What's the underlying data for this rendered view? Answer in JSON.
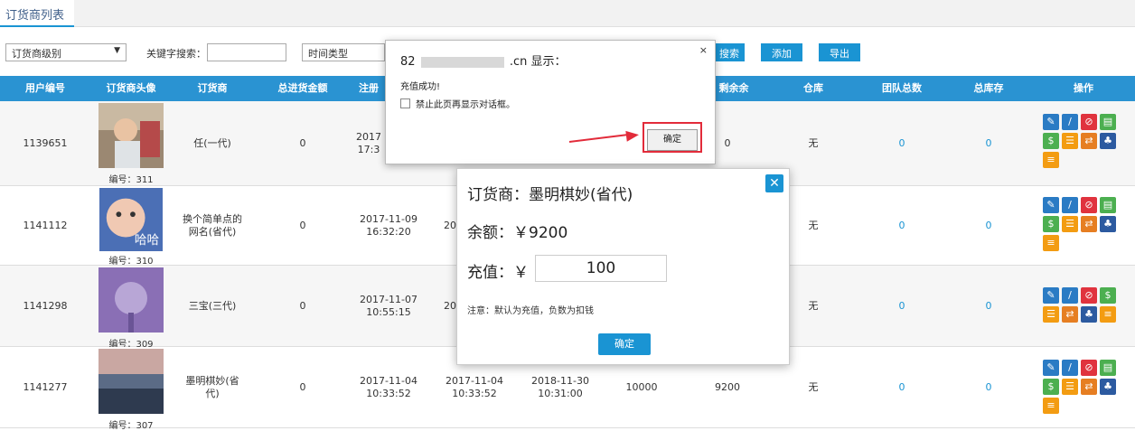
{
  "tab": {
    "label": "订货商列表"
  },
  "filters": {
    "level_select": "订货商级别",
    "keyword_label": "关键字搜索：",
    "keyword_value": "",
    "time_type_select": "时间类型",
    "search_label": "搜索",
    "add_label": "添加",
    "export_label": "导出"
  },
  "table": {
    "headers": [
      "用户编号",
      "订货商头像",
      "订货商",
      "总进货金额",
      "注册",
      "",
      "",
      "剩余余额",
      "仓库",
      "团队总数",
      "总库存",
      "操作"
    ],
    "rows": [
      {
        "id": "1139651",
        "avatar_no": "编号：311",
        "name": "任(一代)",
        "total": "0",
        "reg_date": "2017",
        "reg_time": "17:3",
        "c6": "",
        "c7": "",
        "balance": "0",
        "warehouse": "无",
        "team": "0",
        "stock": "0"
      },
      {
        "id": "1141112",
        "avatar_no": "编号：310",
        "name": "换个简单点的网名(省代)",
        "total": "0",
        "reg_date": "2017-11-09",
        "reg_time": "16:32:20",
        "c6": "20",
        "c7": "",
        "balance": "",
        "warehouse": "无",
        "team": "0",
        "stock": "0"
      },
      {
        "id": "1141298",
        "avatar_no": "编号：309",
        "name": "三宝(三代)",
        "total": "0",
        "reg_date": "2017-11-07",
        "reg_time": "10:55:15",
        "c6": "20",
        "c7": "",
        "balance": "",
        "warehouse": "无",
        "team": "0",
        "stock": "0"
      },
      {
        "id": "1141277",
        "avatar_no": "编号：307",
        "name": "墨明棋妙(省代)",
        "total": "0",
        "reg_date": "2017-11-04",
        "reg_time": "10:33:52",
        "c6_date": "2017-11-04",
        "c6_time": "10:33:52",
        "c7_date": "2018-11-30",
        "c7_time": "10:31:00",
        "c8": "10000",
        "balance": "9200",
        "warehouse": "无",
        "team": "0",
        "stock": "0"
      }
    ]
  },
  "alert": {
    "title_prefix": "82",
    "title_suffix": ".cn 显示：",
    "message": "充值成功!",
    "checkbox_label": "禁止此页再显示对话框。",
    "ok_label": "确定",
    "close_glyph": "×"
  },
  "modal": {
    "title": "订货商：墨明棋妙(省代)",
    "balance_text": "余额：￥9200",
    "recharge_label": "充值：￥",
    "recharge_value": "100",
    "note": "注意：默认为充值，负数为扣钱",
    "ok_label": "确定",
    "close_glyph": "✕"
  },
  "icons": {
    "op_colors": [
      "#2a7bc4",
      "#2a7bc4",
      "#e0333e",
      "#4caf50",
      "#4caf50",
      "#f39c12",
      "#e67e22",
      "#2c5aa0",
      "#f39c12"
    ]
  }
}
